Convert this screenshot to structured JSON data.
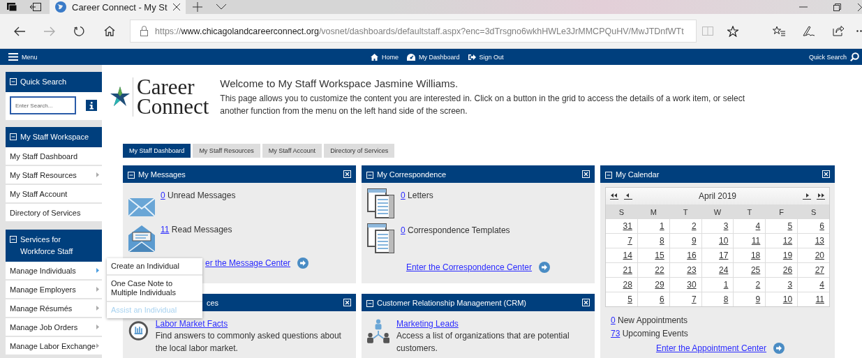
{
  "browser": {
    "tab_title": "Career Connect - My St",
    "url": "https://**www.chicagolandcareerconnect.org**/vosnet/dashboards/defaultstaff.aspx?enc=3dTrsgno6wkhHWLe3JrMMCPQuHV/MwJTDnfWTt"
  },
  "navbar": {
    "menu_label": "Menu",
    "links": [
      "Home",
      "My Dashboard",
      "Sign Out"
    ],
    "quick_search_label": "Quick Search"
  },
  "sidebar": {
    "quick_search": {
      "title": "Quick Search",
      "placeholder": "Enter Search..."
    },
    "sections": [
      {
        "title": "My Staff Workspace",
        "items": [
          {
            "label": "My Staff Dashboard",
            "has_submenu": false,
            "active": false
          },
          {
            "label": "My Staff Resources",
            "has_submenu": true,
            "active": false
          },
          {
            "label": "My Staff Account",
            "has_submenu": false,
            "active": false
          },
          {
            "label": "Directory of Services",
            "has_submenu": false,
            "active": false
          }
        ]
      },
      {
        "title": "Services for Workforce Staff",
        "items": [
          {
            "label": "Manage Individuals",
            "has_submenu": true,
            "active": true
          },
          {
            "label": "Manage Employers",
            "has_submenu": true,
            "active": false
          },
          {
            "label": "Manage Résumés",
            "has_submenu": true,
            "active": false
          },
          {
            "label": "Manage Job Orders",
            "has_submenu": true,
            "active": false
          },
          {
            "label": "Manage Labor Exchange",
            "has_submenu": true,
            "active": false
          }
        ]
      }
    ]
  },
  "submenu": {
    "items": [
      {
        "label": "Create an Individual",
        "hovered": false
      },
      {
        "label": "One Case Note to Multiple Individuals",
        "hovered": false
      },
      {
        "label": "Assist an Individual",
        "hovered": true
      }
    ]
  },
  "logo": {
    "line_1": "Career",
    "line_2": "Connect"
  },
  "welcome": {
    "title": "Welcome to My Staff Workspace Jasmine Williams.",
    "text": "This page allows you to customize the content you are interested in. Click on a button in the grid to access the details of a work item, or select another function from the menu on the left hand side of the screen."
  },
  "tabs": [
    {
      "label": "My Staff Dashboard",
      "selected": true
    },
    {
      "label": "My Staff Resources",
      "selected": false
    },
    {
      "label": "My Staff Account",
      "selected": false
    },
    {
      "label": "Directory of Services",
      "selected": false
    }
  ],
  "messages_panel": {
    "title": "My Messages",
    "lines": [
      {
        "count": "0",
        "text": "Unread Messages"
      },
      {
        "count": "11",
        "text": "Read Messages"
      }
    ],
    "link": "er the Message Center"
  },
  "labor_panel": {
    "title": "ces",
    "link": "Labor Market Facts",
    "text": "Find answers to commonly asked questions about the local labor market."
  },
  "correspondence_panel": {
    "title": "My Correspondence",
    "lines": [
      {
        "count": "0",
        "text": "Letters"
      },
      {
        "count": "0",
        "text": "Correspondence Templates"
      }
    ],
    "link": "Enter the Correspondence Center"
  },
  "crm_panel": {
    "title": "Customer Relationship Management (CRM)",
    "link": "Marketing Leads",
    "text": "Access a list of organizations that are potential customers."
  },
  "calendar_panel": {
    "title": "My Calendar",
    "month": "April 2019",
    "weekdays": [
      "S",
      "M",
      "T",
      "W",
      "T",
      "F",
      "S"
    ],
    "weeks": [
      [
        "31",
        "1",
        "2",
        "3",
        "4",
        "5",
        "6"
      ],
      [
        "7",
        "8",
        "9",
        "10",
        "11",
        "12",
        "13"
      ],
      [
        "14",
        "15",
        "16",
        "17",
        "18",
        "19",
        "20"
      ],
      [
        "21",
        "22",
        "23",
        "24",
        "25",
        "26",
        "27"
      ],
      [
        "28",
        "29",
        "30",
        "1",
        "2",
        "3",
        "4"
      ],
      [
        "5",
        "6",
        "7",
        "8",
        "9",
        "10",
        "11"
      ]
    ],
    "lines": [
      {
        "count": "0",
        "text": "New Appointments"
      },
      {
        "count": "73",
        "text": "Upcoming Events"
      }
    ],
    "link": "Enter the Appointment Center"
  }
}
